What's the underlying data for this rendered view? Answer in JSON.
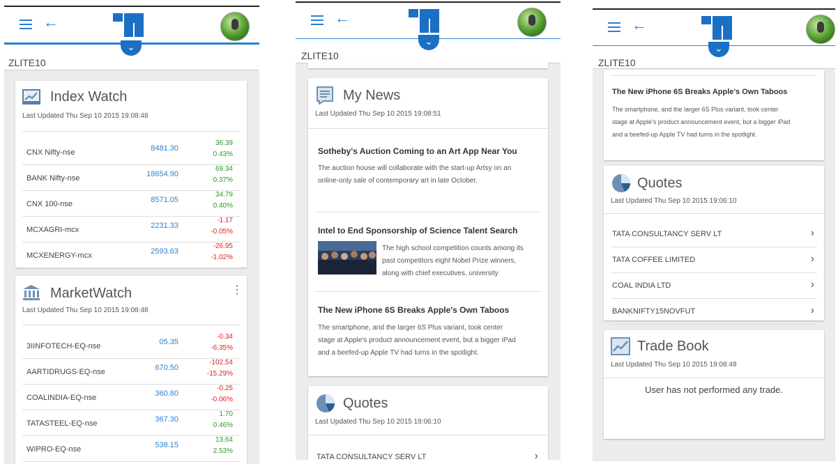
{
  "app": {
    "account": "ZLITE10"
  },
  "index_watch": {
    "title": "Index Watch",
    "updated": "Last Updated Thu Sep 10 2015 19:08:48",
    "rows": [
      {
        "name": "CNX Nifty-nse",
        "price": "8481.30",
        "change": "36.39",
        "pct": "0.43%",
        "dir": "pos"
      },
      {
        "name": "BANK Nifty-nse",
        "price": "18654.90",
        "change": "69.34",
        "pct": "0.37%",
        "dir": "pos"
      },
      {
        "name": "CNX 100-nse",
        "price": "8571.05",
        "change": "34.79",
        "pct": "0.40%",
        "dir": "pos"
      },
      {
        "name": "MCXAGRI-mcx",
        "price": "2231.33",
        "change": "-1.17",
        "pct": "-0.05%",
        "dir": "neg"
      },
      {
        "name": "MCXENERGY-mcx",
        "price": "2593.63",
        "change": "-26.95",
        "pct": "-1.02%",
        "dir": "neg"
      }
    ]
  },
  "market_watch": {
    "title": "MarketWatch",
    "updated": "Last Updated Thu Sep 10 2015 19:08:48",
    "rows": [
      {
        "name": "3IINFOTECH-EQ-nse",
        "price": "05.35",
        "change": "-0.34",
        "pct": "-6.35%",
        "dir": "neg"
      },
      {
        "name": "AARTIDRUGS-EQ-nse",
        "price": "670.50",
        "change": "-102.54",
        "pct": "-15.29%",
        "dir": "neg"
      },
      {
        "name": "COALINDIA-EQ-nse",
        "price": "360.80",
        "change": "-0.25",
        "pct": "-0.06%",
        "dir": "neg"
      },
      {
        "name": "TATASTEEL-EQ-nse",
        "price": "367.30",
        "change": "1.70",
        "pct": "0.46%",
        "dir": "pos"
      },
      {
        "name": "WIPRO-EQ-nse",
        "price": "538.15",
        "change": "13.64",
        "pct": "2.53%",
        "dir": "pos"
      }
    ]
  },
  "my_news": {
    "title": "My News",
    "updated": "Last Updated Thu Sep 10 2015 19:08:51",
    "items": [
      {
        "headline": "Sotheby's Auction Coming to an Art App Near You",
        "body_1": "The auction house will collaborate with the start-up Artsy on an",
        "body_2": "online-only sale of contemporary art in late October."
      },
      {
        "headline": "Intel to End Sponsorship of Science Talent Search",
        "body_1": "The high school competition counts among its",
        "body_2": "past competitors eight Nobel Prize winners,",
        "body_3": "along with chief executives, university"
      },
      {
        "headline": "The New iPhone 6S Breaks Apple's Own Taboos",
        "body_1": "The smartphone, and the larger 6S Plus variant, took center",
        "body_2": "stage at Apple's product announcement event, but a bigger iPad",
        "body_3": "and a beefed-up Apple TV had turns in the spotlight."
      }
    ]
  },
  "quotes": {
    "title": "Quotes",
    "updated": "Last Updated Thu Sep 10 2015 19:06:10",
    "items": [
      "TATA CONSULTANCY SERV LT",
      "TATA COFFEE LIMITED",
      "COAL INDIA LTD",
      "BANKNIFTY15NOVFUT"
    ]
  },
  "trade_book": {
    "title": "Trade Book",
    "updated": "Last Updated Thu Sep 10 2015 19:08:48",
    "empty": "User has not performed any trade."
  },
  "colors": {
    "accent": "#2a7fd0",
    "brand": "#1b6fc4",
    "positive": "#2a9a2a",
    "negative": "#e02020"
  },
  "icons": {
    "menu": "hamburger-icon",
    "back": "back-arrow-icon",
    "expand": "chevron-down-icon"
  },
  "glyphs": {
    "back": "←",
    "chevron_down": "⌄",
    "arrow_right": "›",
    "more": "⋮"
  }
}
